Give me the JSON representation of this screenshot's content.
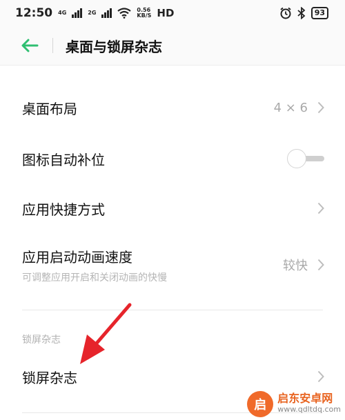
{
  "status_bar": {
    "time": "12:50",
    "sim1": "4G",
    "sim2": "2G",
    "speed_value": "0.56",
    "speed_unit": "KB/S",
    "hd": "HD",
    "battery": "93"
  },
  "header": {
    "title": "桌面与锁屏杂志",
    "back_icon": "arrow-left-icon"
  },
  "settings": [
    {
      "label": "桌面布局",
      "value": "4 × 6",
      "control": "chevron"
    },
    {
      "label": "图标自动补位",
      "control": "toggle",
      "toggle_on": false
    },
    {
      "label": "应用快捷方式",
      "control": "chevron"
    },
    {
      "label": "应用启动动画速度",
      "subtitle": "可调整应用开启和关闭动画的快慢",
      "value": "较快",
      "control": "chevron"
    }
  ],
  "lock_section": {
    "section_label": "锁屏杂志",
    "item_label": "锁屏杂志"
  },
  "watermark": {
    "name": "启东安卓网",
    "url": "www.qdltdq.com"
  },
  "colors": {
    "accent": "#2fbf71",
    "annotation_arrow": "#e6242b"
  }
}
